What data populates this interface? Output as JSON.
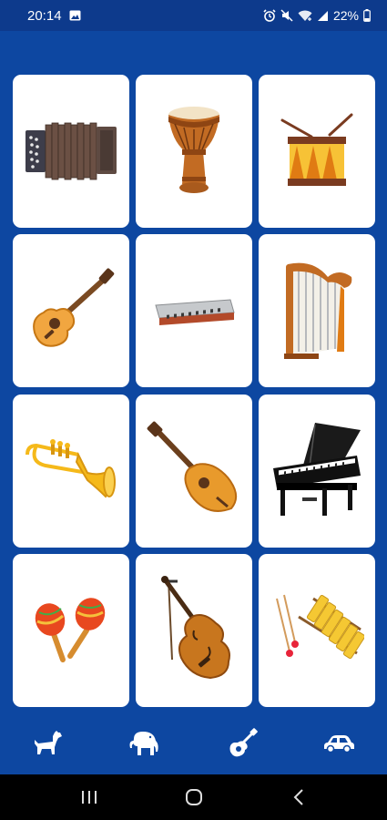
{
  "status_bar": {
    "time": "20:14",
    "battery": "22%"
  },
  "instruments": [
    {
      "name": "accordion",
      "icon": "accordion-icon"
    },
    {
      "name": "djembe",
      "icon": "djembe-icon"
    },
    {
      "name": "drum",
      "icon": "drum-icon"
    },
    {
      "name": "guitar",
      "icon": "guitar-icon"
    },
    {
      "name": "harmonica",
      "icon": "harmonica-icon"
    },
    {
      "name": "harp",
      "icon": "harp-icon"
    },
    {
      "name": "trumpet",
      "icon": "trumpet-icon"
    },
    {
      "name": "mandolin",
      "icon": "mandolin-icon"
    },
    {
      "name": "piano",
      "icon": "piano-icon"
    },
    {
      "name": "maracas",
      "icon": "maracas-icon"
    },
    {
      "name": "violin",
      "icon": "violin-icon"
    },
    {
      "name": "xylophone",
      "icon": "xylophone-icon"
    }
  ],
  "bottom_nav": [
    {
      "name": "dog",
      "icon": "dog-icon"
    },
    {
      "name": "elephant",
      "icon": "elephant-icon"
    },
    {
      "name": "guitar",
      "icon": "guitar-icon",
      "active": true
    },
    {
      "name": "car",
      "icon": "car-icon"
    }
  ],
  "colors": {
    "background": "#0d47a1",
    "status_bar": "#0d3a8c",
    "card": "#ffffff",
    "system_nav": "#000000"
  }
}
